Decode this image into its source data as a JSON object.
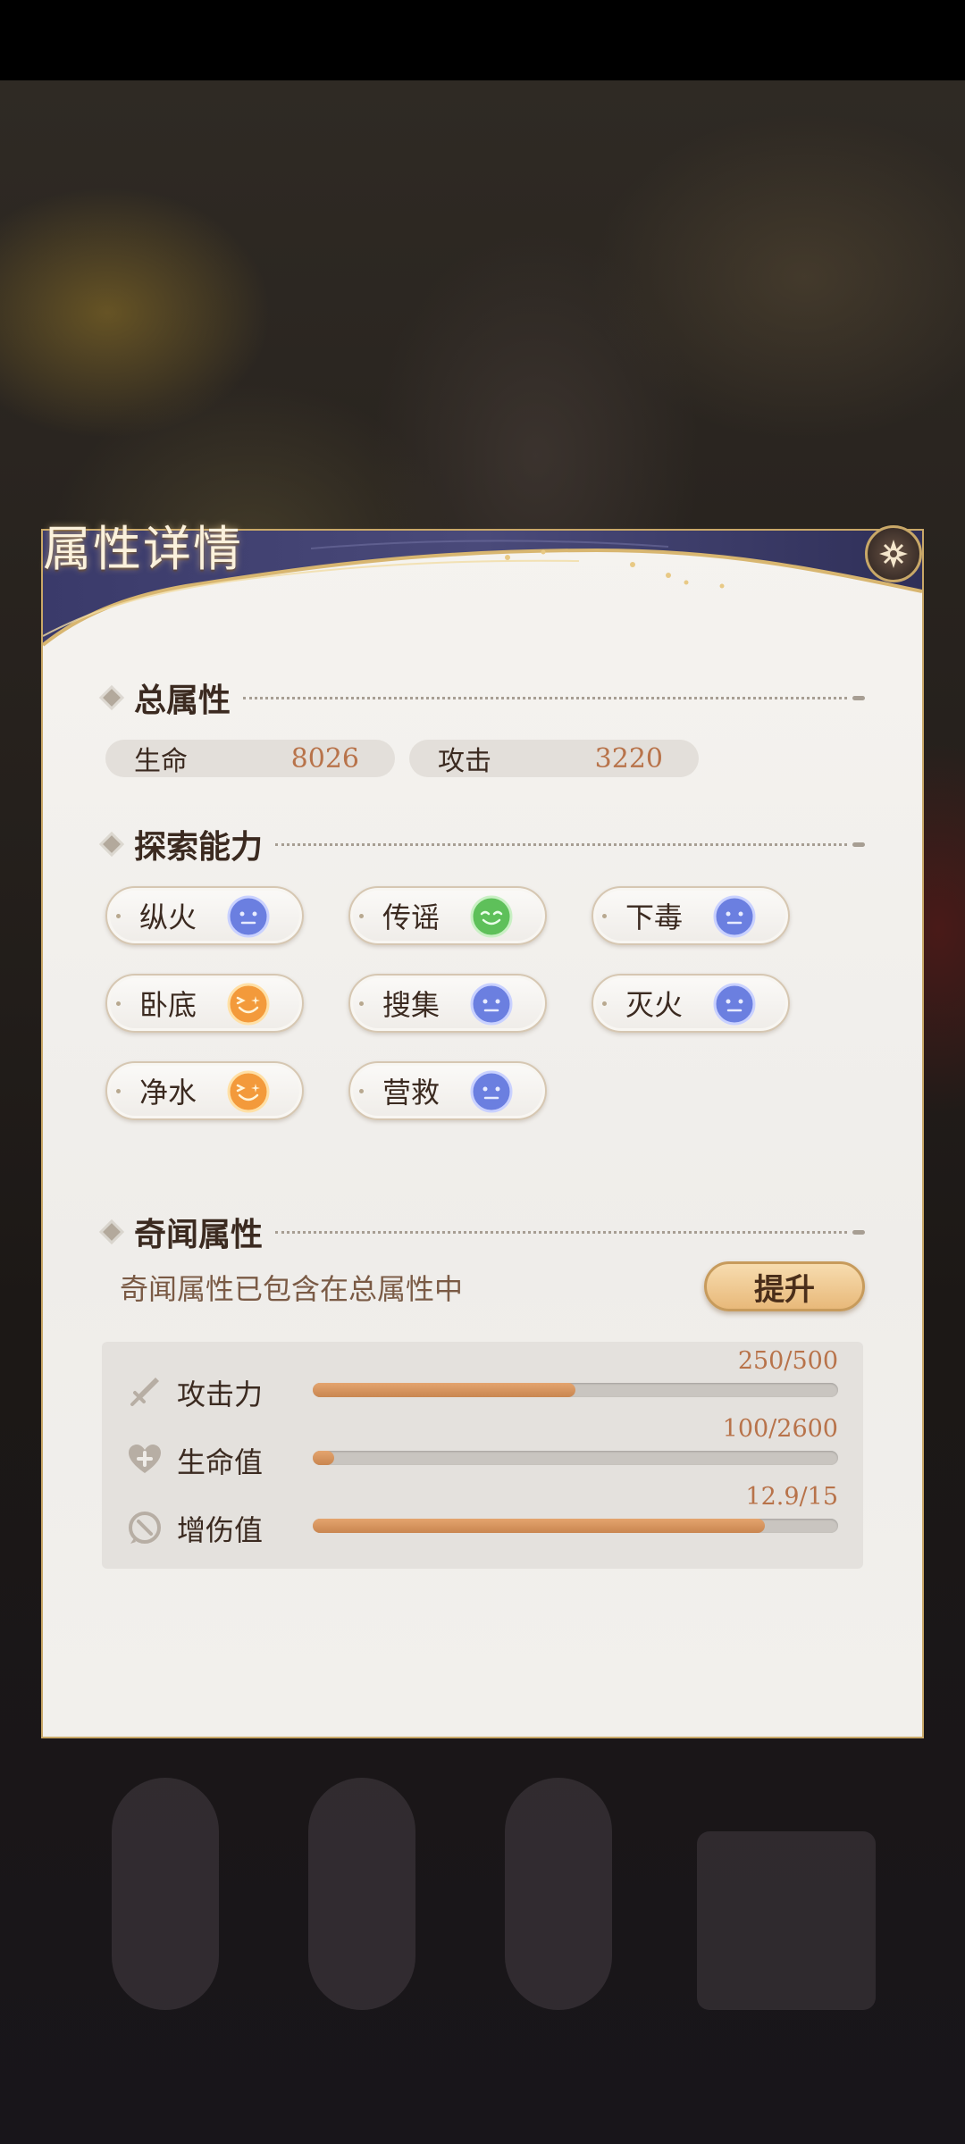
{
  "dialog": {
    "title": "属性详情"
  },
  "total_attributes": {
    "title": "总属性",
    "stats": [
      {
        "label": "生命",
        "value": "8026"
      },
      {
        "label": "攻击",
        "value": "3220"
      }
    ]
  },
  "exploration": {
    "title": "探索能力",
    "abilities": [
      {
        "label": "纵火",
        "face": "neutral-blue-face-icon"
      },
      {
        "label": "传谣",
        "face": "smile-green-face-icon"
      },
      {
        "label": "下毒",
        "face": "neutral-blue-face-icon"
      },
      {
        "label": "卧底",
        "face": "excited-orange-face-icon"
      },
      {
        "label": "搜集",
        "face": "neutral-blue-face-icon"
      },
      {
        "label": "灭火",
        "face": "neutral-blue-face-icon"
      },
      {
        "label": "净水",
        "face": "excited-orange-face-icon"
      },
      {
        "label": "营救",
        "face": "neutral-blue-face-icon"
      }
    ]
  },
  "anecdote": {
    "title": "奇闻属性",
    "note": "奇闻属性已包含在总属性中",
    "upgrade_label": "提升",
    "bars": [
      {
        "label": "攻击力",
        "value_text": "250/500",
        "fraction": 0.5,
        "icon": "sword-icon"
      },
      {
        "label": "生命值",
        "value_text": "100/2600",
        "fraction": 0.04,
        "icon": "heart-plus-icon"
      },
      {
        "label": "增伤值",
        "value_text": "12.9/15",
        "fraction": 0.86,
        "icon": "damage-boost-icon"
      }
    ]
  },
  "colors": {
    "accent": "#b8734a",
    "bar_fill": "#d6935c",
    "face_blue": "#6b7fe0",
    "face_green": "#5ec05a",
    "face_orange": "#f39a3b"
  }
}
